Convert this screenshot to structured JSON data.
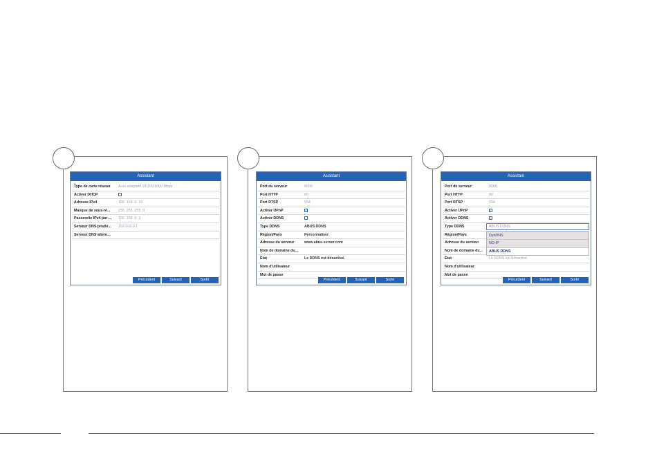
{
  "title": "Assistant",
  "buttons": {
    "prev": "Précédent",
    "next": "Suivant",
    "exit": "Sortir"
  },
  "panel1": {
    "rows": [
      {
        "label": "Type de carte réseau",
        "value": "Auto-adaptatif 10/100/1000 Mbps"
      },
      {
        "label": "Activer DHCP",
        "value": ""
      },
      {
        "label": "Adresse IPv4",
        "value": "192 .168 .0 .10"
      },
      {
        "label": "Masque de sous-ré...",
        "value": "255 .255 .255 .0"
      },
      {
        "label": "Passerelle IPv4 par ...",
        "value": "192 .168 .0 .1"
      },
      {
        "label": "Serveur DNS privilé...",
        "value": "192.168.0.1"
      },
      {
        "label": "Serveur DNS altern...",
        "value": ""
      }
    ]
  },
  "panel2": {
    "rows": [
      {
        "label": "Port du serveur",
        "value": "8000"
      },
      {
        "label": "Port HTTP",
        "value": "80"
      },
      {
        "label": "Port RTSP",
        "value": "554"
      },
      {
        "label": "Activer UPnP",
        "value": ""
      },
      {
        "label": "Activer DDNS",
        "value": ""
      },
      {
        "label": "Type DDNS",
        "value": "ABUS DDNS"
      },
      {
        "label": "Région/Pays",
        "value": "Personnaliser"
      },
      {
        "label": "Adresse du serveur",
        "value": "www.abus-server.com"
      },
      {
        "label": "Nom de domaine du...",
        "value": ""
      },
      {
        "label": "État",
        "value": "Le DDNS est désactivé."
      },
      {
        "label": "Nom d'utilisateur",
        "value": ""
      },
      {
        "label": "Mot de passe",
        "value": ""
      }
    ]
  },
  "panel3": {
    "rows": [
      {
        "label": "Port du serveur",
        "value": "8000"
      },
      {
        "label": "Port HTTP",
        "value": "80"
      },
      {
        "label": "Port RTSP",
        "value": "554"
      },
      {
        "label": "Activer UPnP",
        "value": ""
      },
      {
        "label": "Activer DDNS",
        "value": ""
      },
      {
        "label": "Type DDNS",
        "value": "ABUS DDNS"
      },
      {
        "label": "Région/Pays",
        "value": ""
      },
      {
        "label": "Adresse du serveur",
        "value": ""
      },
      {
        "label": "Nom de domaine du...",
        "value": ""
      },
      {
        "label": "État",
        "value": "Le DDNS est désactivé."
      },
      {
        "label": "Nom d'utilisateur",
        "value": ""
      },
      {
        "label": "Mot de passe",
        "value": ""
      }
    ],
    "dropdown": [
      "DynDNS",
      "NO-IP",
      "ABUS DDNS"
    ]
  },
  "icons": {
    "checkbox_checked": "checkbox-checked-icon",
    "checkbox_empty": "checkbox-empty-icon",
    "cursor": "mouse-cursor-icon"
  }
}
